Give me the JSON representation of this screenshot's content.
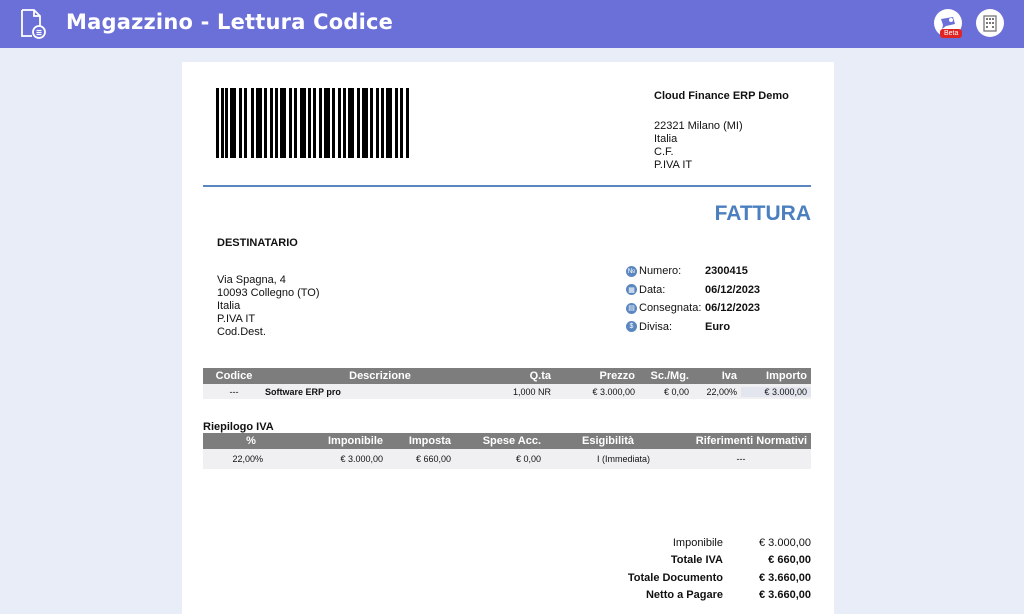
{
  "app": {
    "title": "Magazzino - Lettura Codice",
    "beta_badge": "Beta",
    "icons": [
      "document-icon",
      "chat-icon",
      "building-icon"
    ],
    "accent_color": "#6b70d8"
  },
  "company": {
    "name": "Cloud Finance ERP Demo",
    "address_lines": [
      "22321 Milano (MI)",
      "Italia",
      "C.F.",
      "P.IVA IT"
    ]
  },
  "document": {
    "type_label": "FATTURA",
    "recipient_title": "DESTINATARIO",
    "recipient_lines": [
      "Via Spagna, 4",
      "10093 Collegno (TO)",
      "Italia",
      "P.IVA IT",
      "Cod.Dest."
    ],
    "meta": [
      {
        "label": "Numero:",
        "value": "2300415",
        "icon": "number-icon"
      },
      {
        "label": "Data:",
        "value": "06/12/2023",
        "icon": "calendar-icon"
      },
      {
        "label": "Consegnata:",
        "value": "06/12/2023",
        "icon": "delivery-icon"
      },
      {
        "label": "Divisa:",
        "value": "Euro",
        "icon": "currency-icon"
      }
    ]
  },
  "items": {
    "headers": [
      "Codice",
      "Descrizione",
      "Q.ta",
      "Prezzo",
      "Sc./Mg.",
      "Iva",
      "Importo"
    ],
    "rows": [
      [
        "---",
        "Software ERP pro",
        "1,000 NR",
        "€ 3.000,00",
        "€ 0,00",
        "22,00%",
        "€ 3.000,00"
      ]
    ]
  },
  "vat_summary": {
    "title": "Riepilogo IVA",
    "headers": [
      "%",
      "Imponibile",
      "Imposta",
      "Spese Acc.",
      "Esigibilità",
      "Riferimenti Normativi"
    ],
    "rows": [
      [
        "22,00%",
        "€ 3.000,00",
        "€ 660,00",
        "€ 0,00",
        "I (Immediata)",
        "---"
      ]
    ]
  },
  "totals": [
    {
      "label": "Imponibile",
      "value": "€ 3.000,00",
      "bold": false
    },
    {
      "label": "Totale IVA",
      "value": "€ 660,00",
      "bold": true
    },
    {
      "label": "Totale Documento",
      "value": "€ 3.660,00",
      "bold": true
    },
    {
      "label": "Netto a Pagare",
      "value": "€ 3.660,00",
      "bold": true
    }
  ]
}
